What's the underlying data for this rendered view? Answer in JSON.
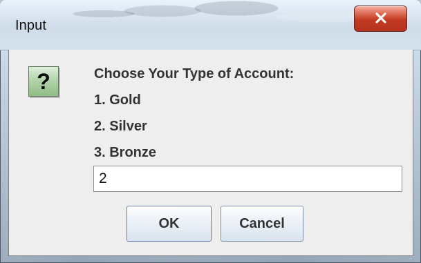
{
  "window": {
    "title": "Input"
  },
  "dialog": {
    "message_lines": [
      "Choose Your Type of Account:",
      "1. Gold",
      "2. Silver",
      "3. Bronze"
    ],
    "input_value": "2",
    "ok_label": "OK",
    "cancel_label": "Cancel",
    "icon": "question-icon"
  },
  "titlebar": {
    "close_icon": "close-icon"
  },
  "colors": {
    "close_button": "#c33a23",
    "dialog_background": "#eeeeee",
    "question_icon": "#b3d3ac",
    "button_border": "#7a8ea8"
  }
}
